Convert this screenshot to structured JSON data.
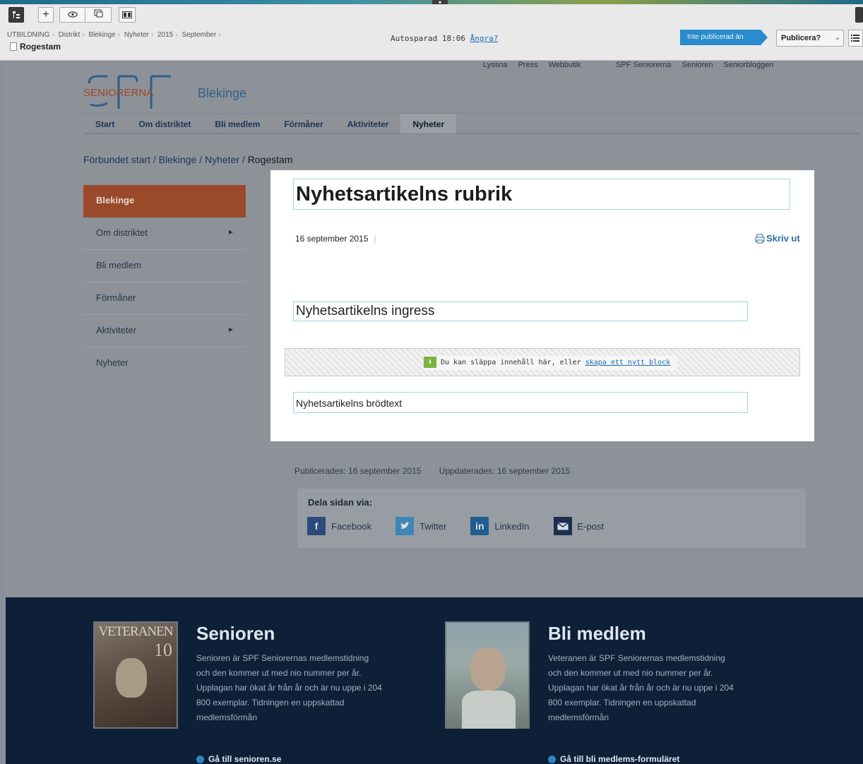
{
  "editor": {
    "breadcrumb": [
      "UTBILDNING",
      "Distrikt",
      "Blekinge",
      "Nyheter",
      "2015",
      "September"
    ],
    "page_name": "Rogestam",
    "autosave_text": "Autosparad 18:06",
    "undo_link": "Ångra?",
    "status": "Inte publicerad än",
    "publish_label": "Publicera?"
  },
  "site": {
    "util_nav": [
      "Lyssna",
      "Press",
      "Webbutik",
      "SPF Seniorerna",
      "Senioren",
      "Seniorbloggen"
    ],
    "logo_text": "SENIORERNA",
    "district": "Blekinge",
    "main_nav": [
      "Start",
      "Om distriktet",
      "Bli medlem",
      "Förmåner",
      "Aktiviteter",
      "Nyheter"
    ],
    "breadcrumb": [
      "Förbundet start",
      "Blekinge",
      "Nyheter",
      "Rogestam"
    ],
    "side_menu": [
      {
        "label": "Blekinge"
      },
      {
        "label": "Om distriktet"
      },
      {
        "label": "Bli medlem"
      },
      {
        "label": "Förmåner"
      },
      {
        "label": "Aktiviteter"
      },
      {
        "label": "Nyheter"
      }
    ]
  },
  "article": {
    "title": "Nyhetsartikelns rubrik",
    "date": "16 september 2015",
    "print_label": "Skriv ut",
    "ingress": "Nyhetsartikelns ingress",
    "dropzone_text": "Du kan släppa innehåll här, eller",
    "dropzone_link": "skapa ett nytt block",
    "body": "Nyhetsartikelns brödtext",
    "published": "Publicerades: 16 september 2015",
    "updated": "Uppdaterades: 16 september 2015"
  },
  "share": {
    "heading": "Dela sidan via:",
    "items": [
      {
        "label": "Facebook",
        "icon": "facebook-icon",
        "color": "#2d4a7e"
      },
      {
        "label": "Twitter",
        "icon": "twitter-icon",
        "color": "#3d86b5"
      },
      {
        "label": "LinkedIn",
        "icon": "linkedin-icon",
        "color": "#1f5e8e"
      },
      {
        "label": "E-post",
        "icon": "mail-icon",
        "color": "#1d2f4f"
      }
    ]
  },
  "footer": {
    "cards": [
      {
        "title": "Senioren",
        "text": "Senioren är SPF Seniorernas medlemstidning och den kommer ut med nio nummer per år. Upplagan har ökat år från år och är nu uppe i 204 800 exemplar. Tidningen en uppskattad medlemsförmån",
        "link": "Gå till senioren.se",
        "image_caption": "VETERANEN"
      },
      {
        "title": "Bli medlem",
        "text": "Veteranen är SPF Seniorernas medlemstidning och den kommer ut med nio nummer per år. Upplagan har ökat år från år och är nu uppe i 204 800 exemplar. Tidningen en uppskattad medlemsförmån",
        "link": "Gå till bli medlems-formuläret"
      }
    ]
  },
  "colors": {
    "accent": "#2a8ccb",
    "side_menu_active": "#9a4a2a",
    "footer_bg": "#0d2038"
  }
}
